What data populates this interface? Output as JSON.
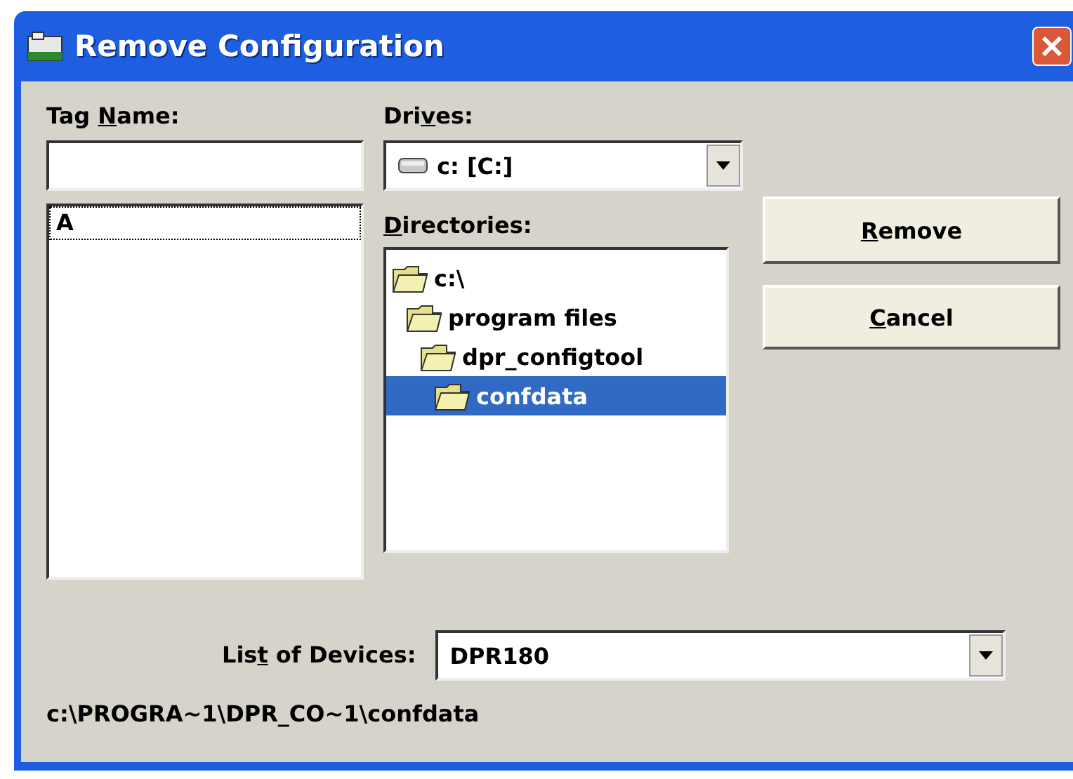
{
  "window": {
    "title": "Remove Configuration"
  },
  "tag_name": {
    "label": {
      "pre": "Tag ",
      "key": "N",
      "post": "ame:"
    }
  },
  "tag_list": {
    "items": [
      {
        "text": "A",
        "selected": true
      }
    ]
  },
  "drives": {
    "label": {
      "pre": "Dri",
      "key": "v",
      "post": "es:"
    },
    "value": "c: [C:]"
  },
  "directories": {
    "label": {
      "key": "D",
      "post": "irectories:"
    },
    "items": [
      {
        "text": "c:\\",
        "selected": false,
        "children": [
          {
            "text": "program files",
            "selected": false,
            "children": [
              {
                "text": "dpr_configtool",
                "selected": false,
                "children": [
                  {
                    "text": "confdata",
                    "selected": true
                  }
                ]
              }
            ]
          }
        ]
      }
    ]
  },
  "buttons": [
    {
      "label": {
        "key": "R",
        "post": "emove"
      }
    },
    {
      "label": {
        "key": "C",
        "post": "ancel"
      }
    }
  ],
  "devices": {
    "label": {
      "pre": "Lis",
      "key": "t",
      "post": " of Devices:"
    },
    "value": "DPR180"
  },
  "path": "c:\\PROGRA~1\\DPR_CO~1\\confdata"
}
